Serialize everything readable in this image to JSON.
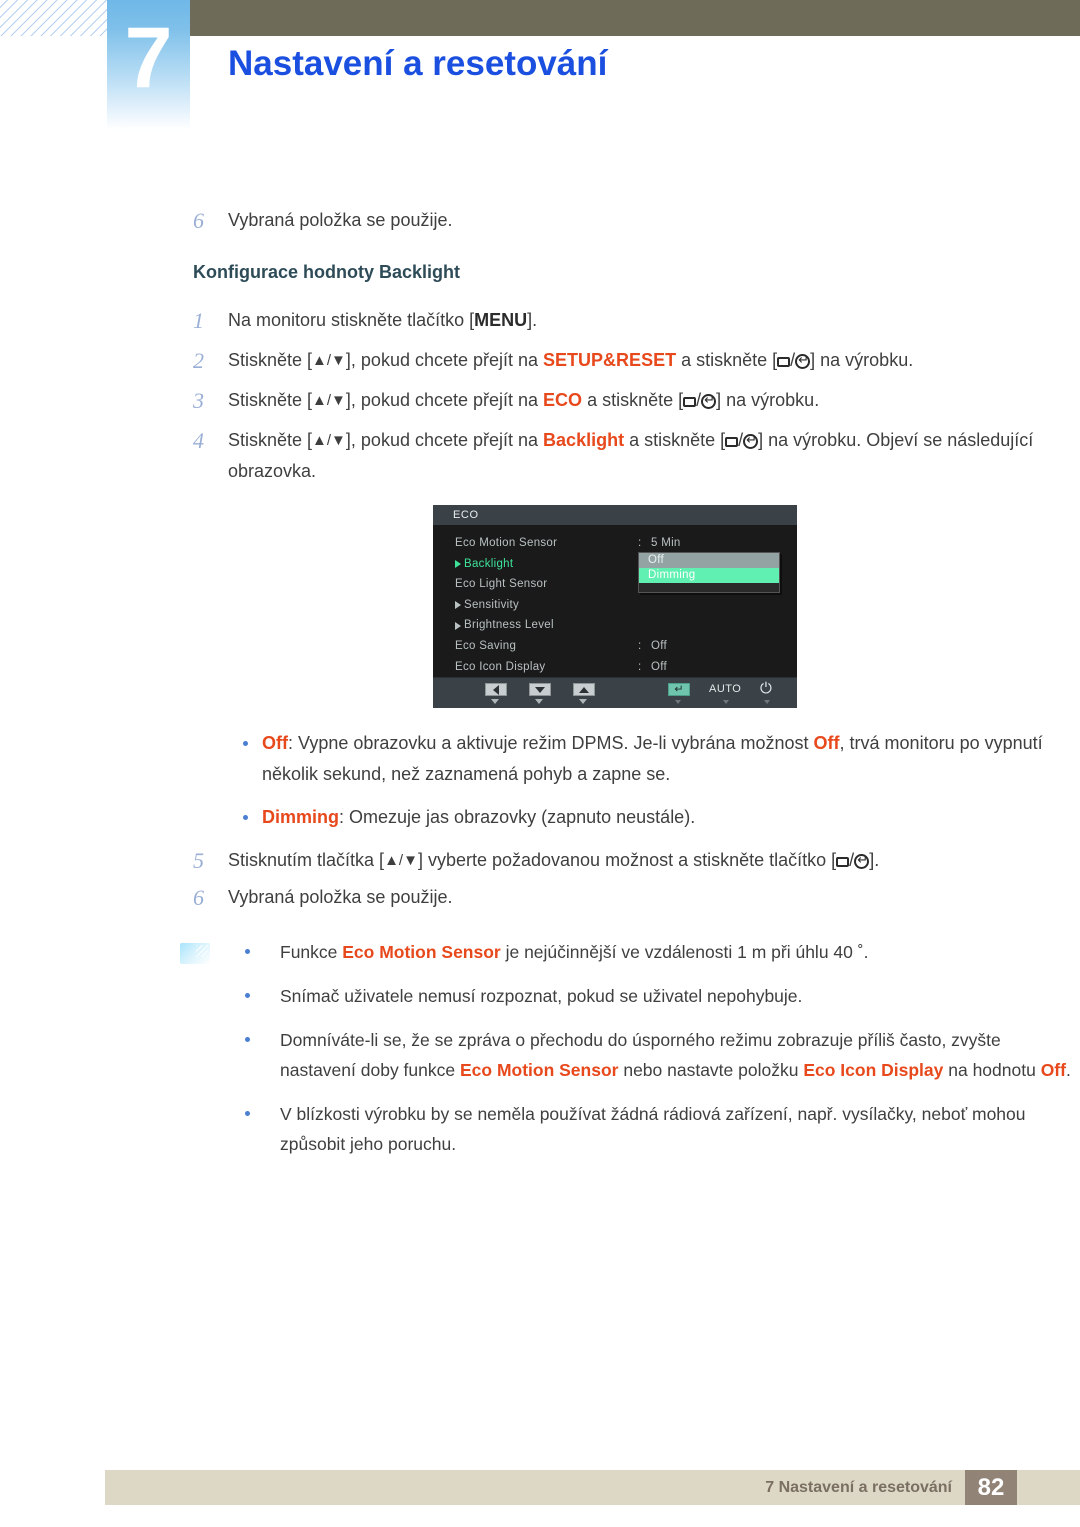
{
  "header": {
    "chapter_number": "7",
    "chapter_title": "Nastavení a resetování"
  },
  "content": {
    "step_top": {
      "num": "6",
      "text": "Vybraná položka se použije."
    },
    "subheading": "Konfigurace hodnoty Backlight",
    "steps": [
      {
        "num": "1",
        "prefix": "Na monitoru stiskněte tlačítko [",
        "kbd": "MENU",
        "suffix": "]."
      },
      {
        "num": "2",
        "a": "Stiskněte [",
        "arrows": "▲/▼",
        "b": "], pokud chcete přejít na ",
        "hl": "SETUP&RESET",
        "c": " a stiskněte [",
        "d": "] na výrobku."
      },
      {
        "num": "3",
        "a": "Stiskněte [",
        "arrows": "▲/▼",
        "b": "], pokud chcete přejít na ",
        "hl": "ECO",
        "c": " a stiskněte [",
        "d": "] na výrobku."
      },
      {
        "num": "4",
        "a": "Stiskněte [",
        "arrows": "▲/▼",
        "b": "], pokud chcete přejít na ",
        "hl": "Backlight",
        "c": " a stiskněte [",
        "d": "] na výrobku. Objeví se následující obrazovka."
      }
    ],
    "bullets": [
      {
        "term": "Off",
        "text": ": Vypne obrazovku a aktivuje režim DPMS. Je-li vybrána možnost ",
        "term2": "Off",
        "text2": ", trvá monitoru po vypnutí několik sekund, než zaznamená pohyb a zapne se."
      },
      {
        "term": "Dimming",
        "text": ": Omezuje jas obrazovky (zapnuto neustále).",
        "term2": "",
        "text2": ""
      }
    ],
    "steps_after": [
      {
        "num": "5",
        "a": "Stisknutím tlačítka [",
        "arrows": "▲/▼",
        "b": "] vyberte požadovanou možnost a stiskněte tlačítko [",
        "d": "]."
      },
      {
        "num": "6",
        "a": "Vybraná položka se použije.",
        "arrows": "",
        "b": "",
        "d": ""
      }
    ],
    "note_bullets": [
      {
        "pre": "Funkce ",
        "hl1": "Eco Motion Sensor",
        "mid": " je nejúčinnější ve vzdálenosti 1 m při úhlu 40 ˚.",
        "hl2": "",
        "post": "",
        "hl3": "",
        "tail": ""
      },
      {
        "pre": "Snímač uživatele nemusí rozpoznat, pokud se uživatel nepohybuje.",
        "hl1": "",
        "mid": "",
        "hl2": "",
        "post": "",
        "hl3": "",
        "tail": ""
      },
      {
        "pre": "Domníváte-li se, že se zpráva o přechodu do úsporného režimu zobrazuje příliš často, zvyšte nastavení doby funkce ",
        "hl1": "Eco Motion Sensor",
        "mid": " nebo nastavte položku ",
        "hl2": "Eco Icon Display",
        "post": " na hodnotu ",
        "hl3": "Off",
        "tail": "."
      },
      {
        "pre": "V blízkosti výrobku by se neměla používat žádná rádiová zařízení, např. vysílačky, neboť mohou způsobit jeho poruchu.",
        "hl1": "",
        "mid": "",
        "hl2": "",
        "post": "",
        "hl3": "",
        "tail": ""
      }
    ]
  },
  "osd": {
    "title": "ECO",
    "rows": [
      {
        "label": "Eco Motion Sensor",
        "arrow": false,
        "colon": ":",
        "value": "5 Min",
        "selected": false
      },
      {
        "label": "Backlight",
        "arrow": true,
        "colon": ":",
        "value": "",
        "selected": true
      },
      {
        "label": "Eco Light Sensor",
        "arrow": false,
        "colon": ":",
        "value": "",
        "selected": false
      },
      {
        "label": "Sensitivity",
        "arrow": true,
        "colon": "",
        "value": "",
        "selected": false
      },
      {
        "label": "Brightness Level",
        "arrow": true,
        "colon": "",
        "value": "",
        "selected": false
      },
      {
        "label": "Eco Saving",
        "arrow": false,
        "colon": ":",
        "value": "Off",
        "selected": false
      },
      {
        "label": "Eco Icon Display",
        "arrow": false,
        "colon": ":",
        "value": "Off",
        "selected": false
      }
    ],
    "popup_options": [
      {
        "label": "Off",
        "state": "off"
      },
      {
        "label": "Dimming",
        "state": "dim"
      }
    ],
    "footer_buttons": [
      {
        "name": "left",
        "glyph": ""
      },
      {
        "name": "down",
        "glyph": ""
      },
      {
        "name": "up",
        "glyph": ""
      },
      {
        "name": "enter",
        "glyph": "↵"
      }
    ],
    "footer_auto": "AUTO",
    "footer_power": "⏻"
  },
  "footer": {
    "text": "7 Nastavení a resetování",
    "page": "82"
  },
  "colors": {
    "accent_blue": "#1a4fe0",
    "highlight_orange": "#e8491c",
    "olive": "#6e6c59",
    "footer_bg": "#ddd7c5",
    "page_badge": "#918477",
    "osd_bg": "#1a1a1a",
    "osd_selected_green": "#3ee39a",
    "osd_dim_green": "#5ff0b2"
  }
}
